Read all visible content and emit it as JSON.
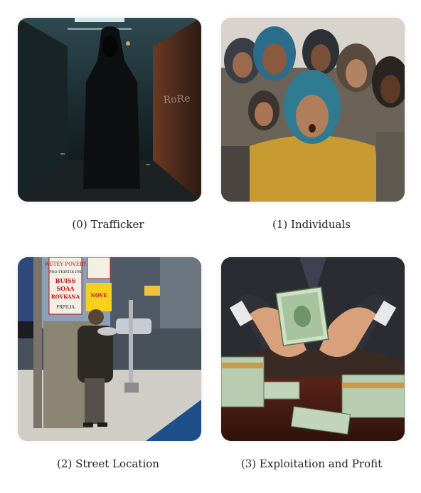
{
  "panels": [
    {
      "caption": "(0) Trafficker",
      "scene": "hooded figure in a dim graffiti-covered alley"
    },
    {
      "caption": "(1) Individuals",
      "scene": "crowd of frightened people in hooded clothing"
    },
    {
      "caption": "(2) Street Location",
      "scene": "man with a bowl at a street corner next to posted signs",
      "signs": [
        "WETEY POVERY",
        "PRO FRIRTIR PRI",
        "BUISS",
        "SOAA",
        "ROVKANA",
        "FRPILIA",
        "NOVE"
      ]
    },
    {
      "caption": "(3) Exploitation and Profit",
      "scene": "hands in a suit holding stacks of cash over a table"
    }
  ]
}
